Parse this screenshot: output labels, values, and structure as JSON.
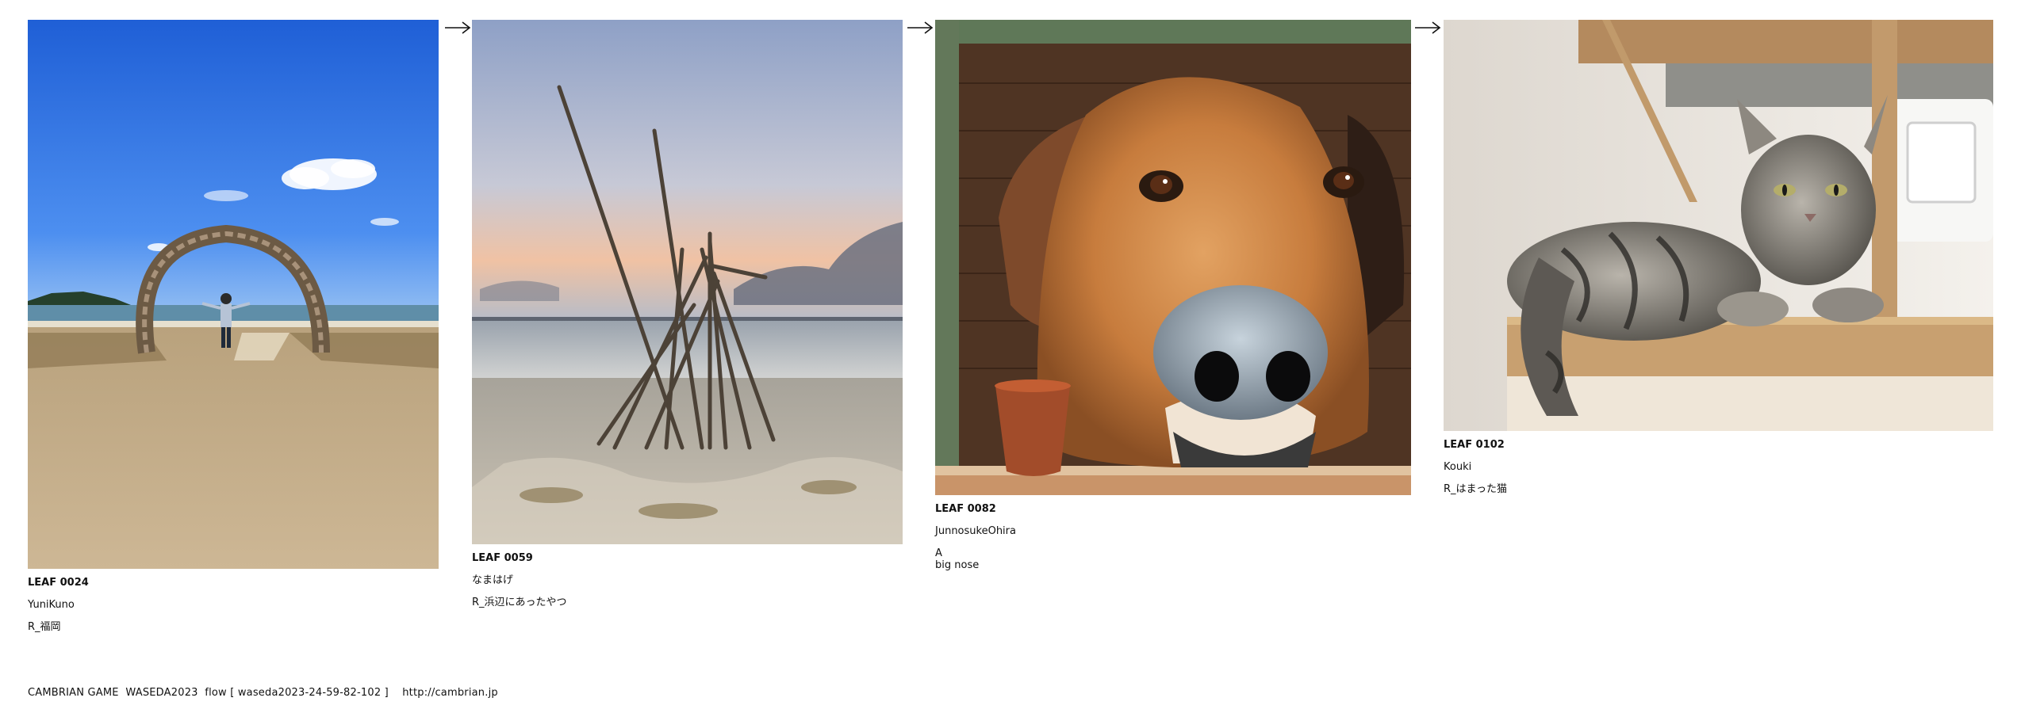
{
  "leaves": [
    {
      "code": "LEAF 0024",
      "author": "YuniKuno",
      "title": "R_福岡"
    },
    {
      "code": "LEAF 0059",
      "author": "なまはげ",
      "title": "R_浜辺にあったやつ"
    },
    {
      "code": "LEAF 0082",
      "author": "JunnosukeOhira",
      "title": "A\nbig nose"
    },
    {
      "code": "LEAF 0102",
      "author": "Kouki",
      "title": "R_はまった猫"
    }
  ],
  "footer": {
    "text": "CAMBRIAN GAME  WASEDA2023  flow [ waseda2023-24-59-82-102 ]    http://cambrian.jp"
  },
  "icons": {
    "flow_arrow": "right-arrow-icon"
  },
  "colors": {
    "text": "#111111",
    "background": "#ffffff"
  }
}
